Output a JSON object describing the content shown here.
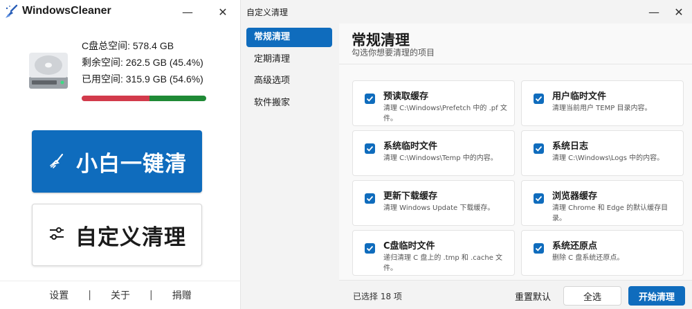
{
  "colors": {
    "accent": "#0f6cbd",
    "used": "#d23a4b",
    "free": "#1f8a36"
  },
  "main_window": {
    "title": "WindowsCleaner",
    "logo_icon": "broom-logo-icon",
    "controls": {
      "minimize": "—",
      "close": "✕"
    },
    "disk": {
      "total_label": "C盘总空间: 578.4 GB",
      "free_label": "剩余空间: 262.5 GB (45.4%)",
      "used_label": "已用空间: 315.9 GB (54.6%)",
      "used_percent": 54.6
    },
    "oneclick_label": "小白一键清",
    "custom_label": "自定义清理",
    "footer": {
      "settings": "设置",
      "about": "关于",
      "donate": "捐赠",
      "sep": "|"
    }
  },
  "custom_window": {
    "title": "自定义清理",
    "controls": {
      "minimize": "—",
      "close": "✕"
    },
    "nav": [
      "常规清理",
      "定期清理",
      "高级选项",
      "软件搬家"
    ],
    "section_title": "常规清理",
    "section_subtitle": "勾选你想要清理的项目",
    "items": [
      {
        "title": "预读取缓存",
        "desc": "清理 C:\\Windows\\Prefetch 中的 .pf 文件。",
        "checked": true
      },
      {
        "title": "用户临时文件",
        "desc": "清理当前用户 TEMP 目录内容。",
        "checked": true
      },
      {
        "title": "系统临时文件",
        "desc": "清理 C:\\Windows\\Temp 中的内容。",
        "checked": true
      },
      {
        "title": "系统日志",
        "desc": "清理 C:\\Windows\\Logs 中的内容。",
        "checked": true
      },
      {
        "title": "更新下载缓存",
        "desc": "清理 Windows Update 下载缓存。",
        "checked": true
      },
      {
        "title": "浏览器缓存",
        "desc": "清理 Chrome 和 Edge 的默认缓存目录。",
        "checked": true
      },
      {
        "title": "C盘临时文件",
        "desc": "递归清理 C 盘上的 .tmp 和 .cache 文件。",
        "checked": true
      },
      {
        "title": "系统还原点",
        "desc": "删除 C 盘系统还原点。",
        "checked": true
      }
    ],
    "footer": {
      "selected_count": "已选择 18 项",
      "reset": "重置默认",
      "select_all": "全选",
      "start": "开始清理"
    }
  }
}
